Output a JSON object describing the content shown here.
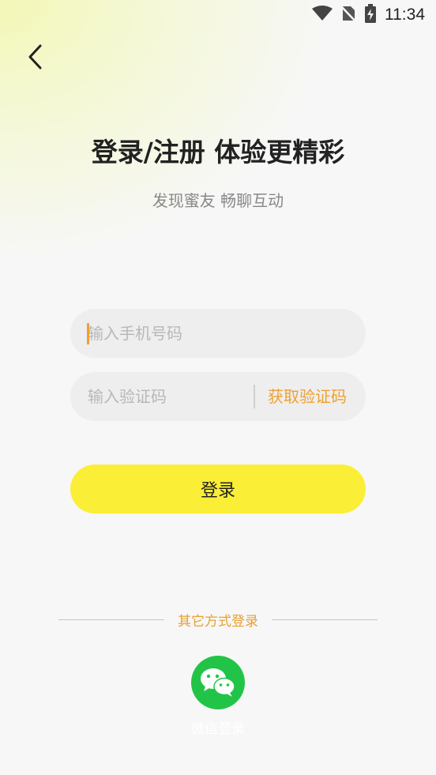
{
  "status_bar": {
    "time": "11:34"
  },
  "header": {
    "title": "登录/注册 体验更精彩",
    "subtitle": "发现蜜友 畅聊互动"
  },
  "form": {
    "phone_placeholder": "输入手机号码",
    "code_placeholder": "输入验证码",
    "get_code_label": "获取验证码",
    "login_label": "登录"
  },
  "other_login": {
    "label": "其它方式登录",
    "wechat_label": "微信登录"
  },
  "colors": {
    "accent": "#f0a030",
    "login_button": "#fbee36",
    "wechat_green": "#22c448"
  }
}
